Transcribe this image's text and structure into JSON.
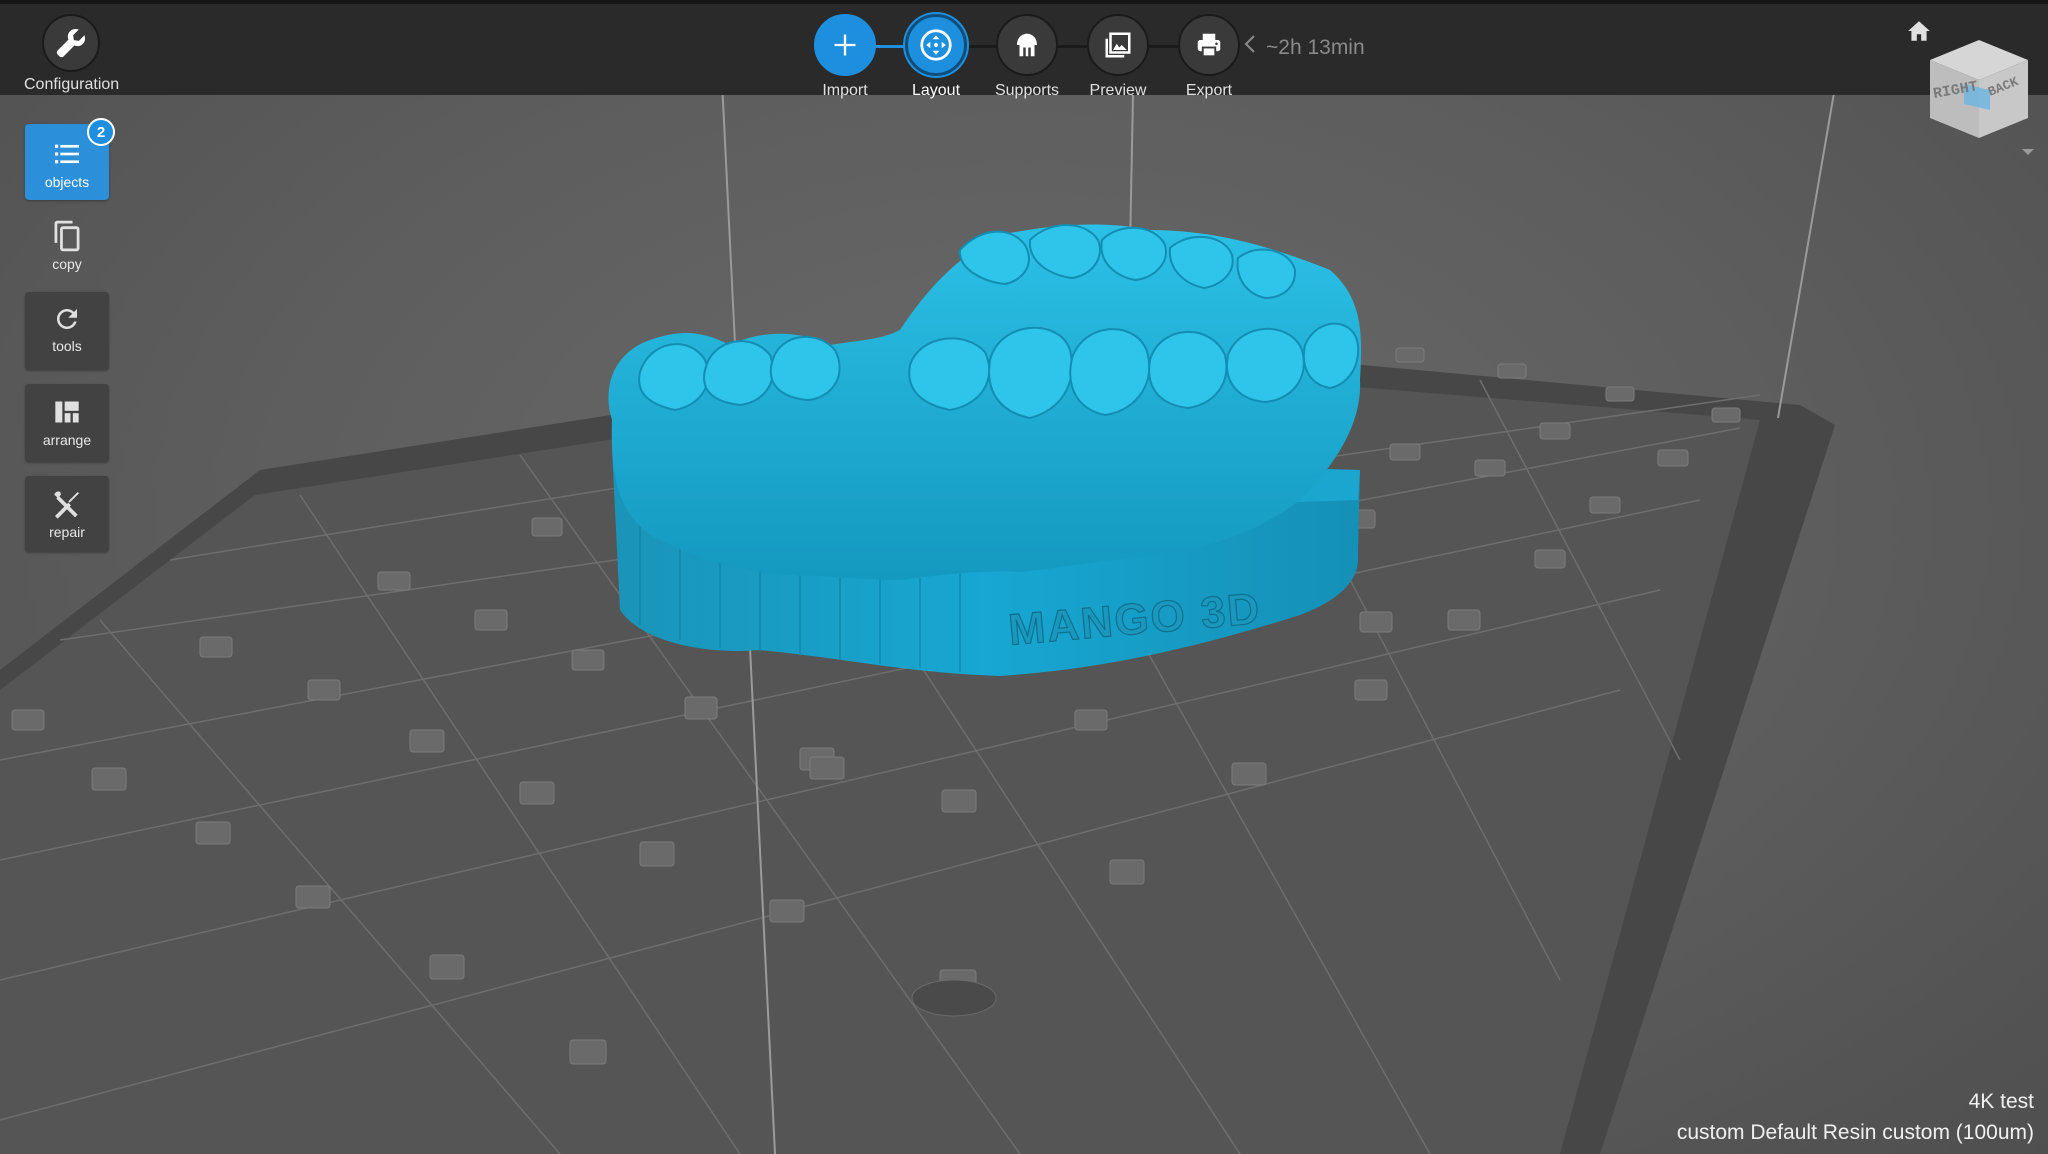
{
  "header": {
    "configuration_label": "Configuration",
    "steps": [
      {
        "key": "import",
        "label": "Import",
        "icon": "plus-icon"
      },
      {
        "key": "layout",
        "label": "Layout",
        "icon": "move-icon"
      },
      {
        "key": "supports",
        "label": "Supports",
        "icon": "supports-icon"
      },
      {
        "key": "preview",
        "label": "Preview",
        "icon": "image-icon"
      },
      {
        "key": "export",
        "label": "Export",
        "icon": "printer-icon"
      }
    ],
    "active_step": "Layout",
    "print_time": "~2h 13min"
  },
  "sidebar": {
    "objects": {
      "label": "objects",
      "count": "2"
    },
    "copy": {
      "label": "copy"
    },
    "tools": {
      "label": "tools"
    },
    "arrange": {
      "label": "arrange"
    },
    "repair": {
      "label": "repair"
    }
  },
  "viewcube": {
    "face_left": "RIGHT",
    "face_right": "BACK"
  },
  "model": {
    "embossed_text": "MANGO 3D",
    "color": "#1aa3c9"
  },
  "footer": {
    "printer": "4K test",
    "material": "custom Default Resin custom (100um)"
  },
  "colors": {
    "accent": "#1e8fde",
    "toolbar_bg": "#2a2a2a",
    "viewport_bg": "#5c5c5c"
  }
}
